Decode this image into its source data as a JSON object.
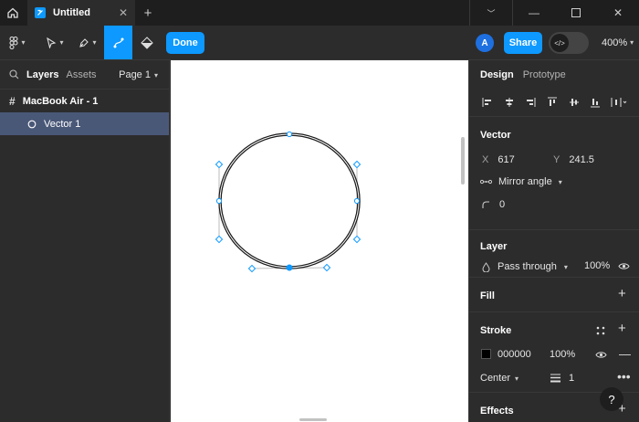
{
  "window": {
    "tab_title": "Untitled"
  },
  "toolbar": {
    "done_label": "Done",
    "avatar_letter": "A",
    "share_label": "Share",
    "zoom_label": "400%"
  },
  "left_panel": {
    "tabs": [
      "Layers",
      "Assets"
    ],
    "page_label": "Page 1",
    "layers": [
      {
        "name": "MacBook Air - 1",
        "icon": "frame-icon"
      },
      {
        "name": "Vector 1",
        "icon": "ellipse-icon"
      }
    ]
  },
  "right_panel": {
    "tabs": [
      "Design",
      "Prototype"
    ],
    "vector": {
      "title": "Vector",
      "x_label": "X",
      "x_value": "617",
      "y_label": "Y",
      "y_value": "241.5",
      "mirror_label": "Mirror angle",
      "radius_value": "0"
    },
    "layer": {
      "title": "Layer",
      "blend_mode": "Pass through",
      "opacity": "100%"
    },
    "fill": {
      "title": "Fill"
    },
    "stroke": {
      "title": "Stroke",
      "color_hex": "000000",
      "opacity": "100%",
      "position": "Center",
      "weight": "1"
    },
    "effects": {
      "title": "Effects"
    }
  },
  "help": {
    "label": "?"
  },
  "colors": {
    "accent": "#0d99ff",
    "selection": "#4a5878",
    "stroke_swatch": "#000000"
  }
}
